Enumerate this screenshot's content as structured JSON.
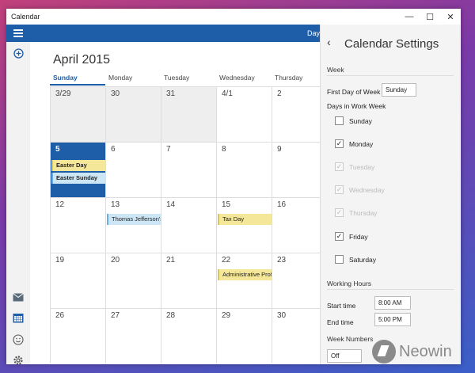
{
  "window": {
    "title": "Calendar",
    "minimize": "—",
    "maximize": "☐",
    "close": "✕"
  },
  "topbar": {
    "day_link": "Day"
  },
  "calendar": {
    "month_title": "April 2015",
    "days_of_week": [
      "Sunday",
      "Monday",
      "Tuesday",
      "Wednesday",
      "Thursday"
    ],
    "weeks": [
      [
        "3/29",
        "30",
        "31",
        "4/1",
        "2"
      ],
      [
        "5",
        "6",
        "7",
        "8",
        "9"
      ],
      [
        "12",
        "13",
        "14",
        "15",
        "16"
      ],
      [
        "19",
        "20",
        "21",
        "22",
        "23"
      ],
      [
        "26",
        "27",
        "28",
        "29",
        "30"
      ]
    ],
    "events": {
      "easter_day": "Easter Day",
      "easter_sunday": "Easter Sunday",
      "jefferson": "Thomas Jefferson's B",
      "tax_day": "Tax Day",
      "admin": "Administrative Profe"
    }
  },
  "settings": {
    "title": "Calendar Settings",
    "back_glyph": "‹",
    "week_section": "Week",
    "first_day_label": "First Day of Week",
    "first_day_value": "Sunday",
    "work_week_label": "Days in Work Week",
    "days": [
      {
        "label": "Sunday",
        "checked": false,
        "disabled": false
      },
      {
        "label": "Monday",
        "checked": true,
        "disabled": false
      },
      {
        "label": "Tuesday",
        "checked": true,
        "disabled": true
      },
      {
        "label": "Wednesday",
        "checked": true,
        "disabled": true
      },
      {
        "label": "Thursday",
        "checked": true,
        "disabled": true
      },
      {
        "label": "Friday",
        "checked": true,
        "disabled": false
      },
      {
        "label": "Saturday",
        "checked": false,
        "disabled": false
      }
    ],
    "working_hours_section": "Working Hours",
    "start_label": "Start time",
    "start_value": "8:00 AM",
    "end_label": "End time",
    "end_value": "5:00 PM",
    "week_numbers_section": "Week Numbers",
    "week_numbers_value": "Off"
  },
  "watermark": {
    "text": "Neowin"
  },
  "colors": {
    "accent": "#1e5ea8",
    "event_yellow": "#f4e79a",
    "event_blue": "#cde6f5"
  },
  "icons": [
    "hamburger-icon",
    "add-icon",
    "mail-icon",
    "calendar-icon",
    "smiley-icon",
    "gear-icon"
  ]
}
